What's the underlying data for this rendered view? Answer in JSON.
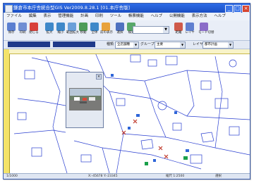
{
  "window": {
    "title": "鎌倉市本庁舎統合型GIS Ver2009.8.28.1 [01.本庁舎版]",
    "minimize_label": "_",
    "maximize_label": "□",
    "close_label": "×"
  },
  "menu": {
    "items": [
      "ファイル",
      "編集",
      "表示",
      "管理機能",
      "計画",
      "印刷",
      "ツール",
      "帳票機能",
      "ヘルプ",
      "公開機能",
      "表示方法",
      "ヘルプ"
    ]
  },
  "toolbar": {
    "buttons": [
      {
        "label": "保存",
        "icon": "save-icon",
        "color": "#5a7fd1"
      },
      {
        "label": "印刷",
        "icon": "print-icon",
        "color": "#6f8fd4"
      },
      {
        "label": "閉じる",
        "icon": "close-icon",
        "color": "#d8403a"
      },
      {
        "label": "拡大",
        "icon": "zoom-in-icon",
        "color": "#3e88c9"
      },
      {
        "label": "縮小",
        "icon": "zoom-out-icon",
        "color": "#3e88c9"
      },
      {
        "label": "範囲拡大",
        "icon": "zoom-area-icon",
        "color": "#6aa0d9"
      },
      {
        "label": "移動",
        "icon": "pan-icon",
        "color": "#4c9b57"
      },
      {
        "label": "全体",
        "icon": "full-extent-icon",
        "color": "#3e88c9"
      },
      {
        "label": "前の表示",
        "icon": "back-icon",
        "color": "#e8a23b"
      },
      {
        "label": "選択",
        "icon": "select-icon",
        "color": "#4f72c0"
      },
      {
        "label": "検索",
        "icon": "search-icon",
        "color": "#58a86a"
      },
      {
        "label": "距離",
        "icon": "measure-icon",
        "color": "#cf5a4a"
      },
      {
        "label": "レイヤ",
        "icon": "layer-icon",
        "color": "#5f7fd0"
      },
      {
        "label": "モード切替",
        "icon": "mode-icon",
        "color": "#8a6cc8"
      }
    ],
    "combo_value": ""
  },
  "filter": {
    "type_label": "種類",
    "type_value": "全店舗種",
    "group_label": "グループ",
    "group_value": "主要",
    "layer_label": "レイヤ",
    "layer_value": "都市計画"
  },
  "photo_popup": {
    "close_label": "×"
  },
  "status": {
    "left": "1/1000",
    "coords": "X:-45678 Y:-23345",
    "scale": "縮尺 1:2500",
    "mode": "選択"
  }
}
